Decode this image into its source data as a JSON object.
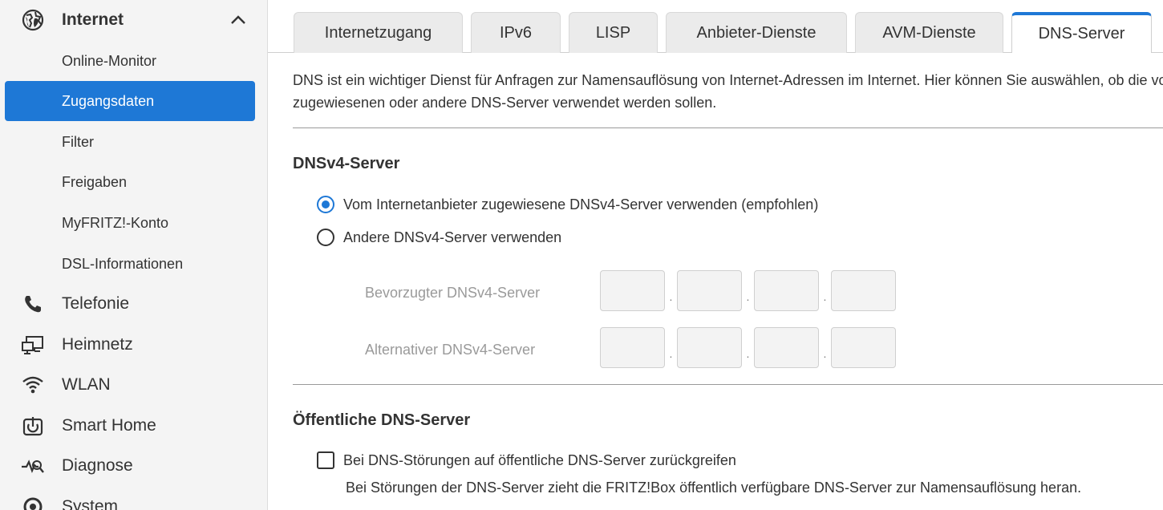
{
  "sidebar": {
    "internet": {
      "label": "Internet",
      "icon": "globe-icon"
    },
    "sub_items": [
      {
        "label": "Online-Monitor"
      },
      {
        "label": "Zugangsdaten",
        "active": true
      },
      {
        "label": "Filter"
      },
      {
        "label": "Freigaben"
      },
      {
        "label": "MyFRITZ!-Konto"
      },
      {
        "label": "DSL-Informationen"
      }
    ],
    "main_items": [
      {
        "label": "Telefonie",
        "icon": "phone-icon"
      },
      {
        "label": "Heimnetz",
        "icon": "network-icon"
      },
      {
        "label": "WLAN",
        "icon": "wifi-icon"
      },
      {
        "label": "Smart Home",
        "icon": "smart-home-icon"
      },
      {
        "label": "Diagnose",
        "icon": "diagnose-icon"
      },
      {
        "label": "System",
        "icon": "system-icon"
      }
    ]
  },
  "tabs": [
    {
      "label": "Internetzugang"
    },
    {
      "label": "IPv6"
    },
    {
      "label": "LISP"
    },
    {
      "label": "Anbieter-Dienste"
    },
    {
      "label": "AVM-Dienste"
    },
    {
      "label": "DNS-Server",
      "active": true
    }
  ],
  "content": {
    "intro_line1": "DNS ist ein wichtiger Dienst für Anfragen zur Namensauflösung von Internet-Adressen im Internet. Hier können Sie auswählen, ob die vom Internetanbieter",
    "intro_line2": "zugewiesenen oder andere DNS-Server verwendet werden sollen.",
    "dnsv4": {
      "title": "DNSv4-Server",
      "option_provider": "Vom Internetanbieter zugewiesene DNSv4-Server verwenden (empfohlen)",
      "option_other": "Andere DNSv4-Server verwenden",
      "preferred_label": "Bevorzugter DNSv4-Server",
      "alternative_label": "Alternativer DNSv4-Server",
      "dot": "."
    },
    "public_dns": {
      "title": "Öffentliche DNS-Server",
      "checkbox_label": "Bei DNS-Störungen auf öffentliche DNS-Server zurückgreifen",
      "hint": "Bei Störungen der DNS-Server zieht die FRITZ!Box öffentlich verfügbare DNS-Server zur Namensauflösung heran."
    }
  },
  "colors": {
    "accent": "#1e78d6",
    "sidebar_bg": "#f4f4f4"
  }
}
